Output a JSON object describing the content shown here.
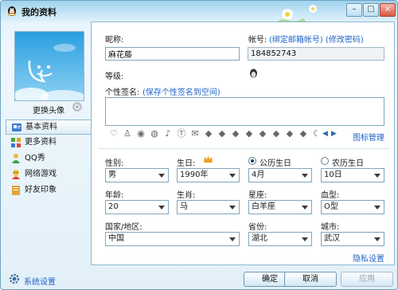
{
  "window": {
    "title": "我的资料",
    "min_label": "–",
    "max_label": "□",
    "close_label": "×"
  },
  "sidebar": {
    "change_avatar_label": "更换头像",
    "items": [
      {
        "label": "基本资料",
        "icon": "card-icon",
        "active": true
      },
      {
        "label": "更多资料",
        "icon": "grid-icon"
      },
      {
        "label": "QQ秀",
        "icon": "qqshow-icon"
      },
      {
        "label": "网络游戏",
        "icon": "game-icon"
      },
      {
        "label": "好友印象",
        "icon": "notebook-icon"
      }
    ],
    "settings_label": "系统设置"
  },
  "profile": {
    "nickname_label": "昵称:",
    "nickname_value": "麻花藤",
    "account_label": "帐号:",
    "bind_email_link": "(绑定邮箱帐号)",
    "change_password_link": "(修改密码)",
    "account_value": "184852743",
    "level_label": "等级:",
    "signature_label": "个性签名:",
    "save_signature_link": "(保存个性签名到空间)",
    "icon_manage_link": "图标管理"
  },
  "details": {
    "gender_label": "性别:",
    "gender_value": "男",
    "birthday_label": "生日:",
    "year_value": "1990年",
    "solar_label": "公历生日",
    "lunar_label": "农历生日",
    "month_value": "4月",
    "day_value": "10日",
    "age_label": "年龄:",
    "age_value": "20",
    "zodiac_label": "生肖:",
    "zodiac_value": "马",
    "constellation_label": "星座:",
    "constellation_value": "白羊座",
    "blood_label": "血型:",
    "blood_value": "O型",
    "country_label": "国家/地区:",
    "country_value": "中国",
    "province_label": "省份:",
    "province_value": "湖北",
    "city_label": "城市:",
    "city_value": "武汉",
    "privacy_link": "隐私设置"
  },
  "footer": {
    "ok_label": "确定",
    "cancel_label": "取消",
    "apply_label": "应用"
  },
  "colors": {
    "accent_blue": "#1f64c8",
    "panel_border": "#8db7d2",
    "window_bg": "#e6f3fb"
  }
}
